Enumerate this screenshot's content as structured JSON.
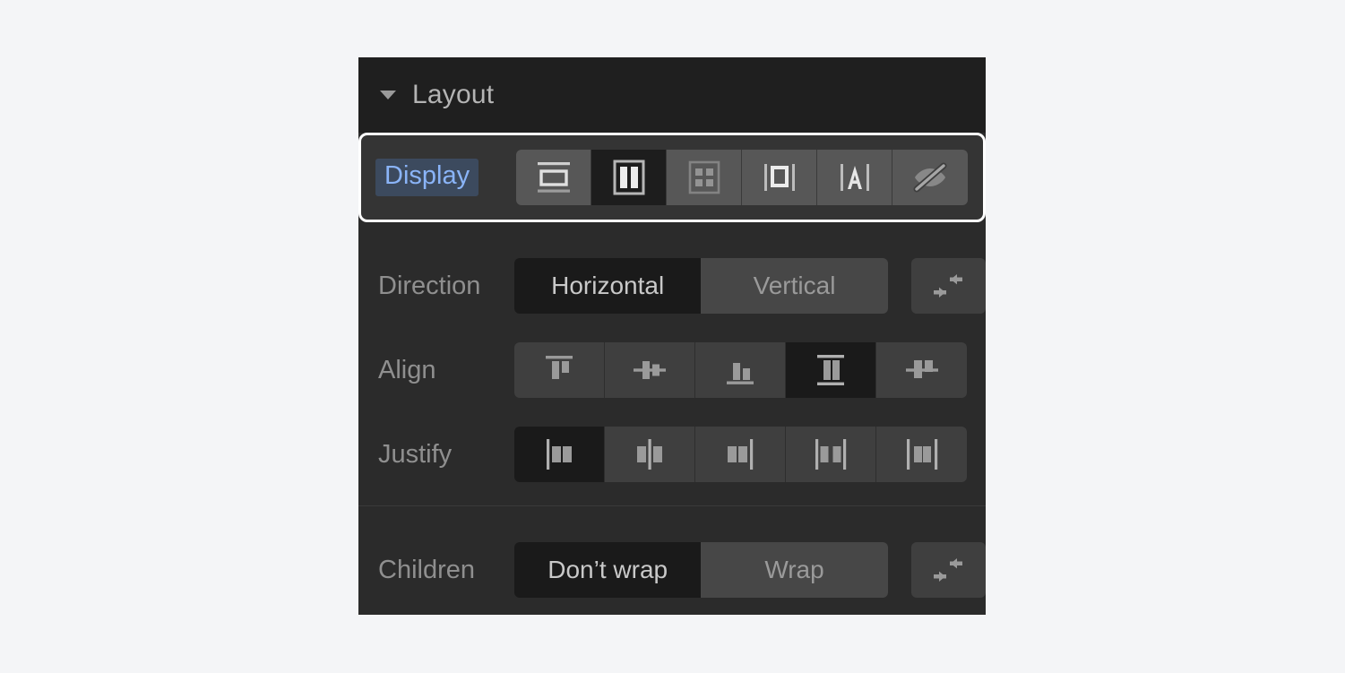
{
  "panel": {
    "title": "Layout",
    "disclosure_icon": "triangle-down-icon",
    "expanded": true
  },
  "display": {
    "label": "Display",
    "focused": true,
    "selected": "flex",
    "options": [
      {
        "value": "block",
        "icon": "display-block-icon",
        "selected": false,
        "dim": false
      },
      {
        "value": "flex",
        "icon": "display-flex-icon",
        "selected": true,
        "dim": false
      },
      {
        "value": "grid",
        "icon": "display-grid-icon",
        "selected": false,
        "dim": true
      },
      {
        "value": "inline-block",
        "icon": "display-inline-block-icon",
        "selected": false,
        "dim": false
      },
      {
        "value": "inline",
        "icon": "display-inline-icon",
        "selected": false,
        "dim": false
      },
      {
        "value": "none",
        "icon": "display-none-icon",
        "selected": false,
        "dim": false
      }
    ]
  },
  "direction": {
    "label": "Direction",
    "selected": "Horizontal",
    "options": [
      {
        "label": "Horizontal",
        "selected": true
      },
      {
        "label": "Vertical",
        "selected": false
      }
    ],
    "reverse_icon": "direction-reverse-icon"
  },
  "align": {
    "label": "Align",
    "selected": "stretch",
    "options": [
      {
        "value": "start",
        "icon": "align-start-icon",
        "selected": false
      },
      {
        "value": "center",
        "icon": "align-center-icon",
        "selected": false
      },
      {
        "value": "end",
        "icon": "align-end-icon",
        "selected": false
      },
      {
        "value": "stretch",
        "icon": "align-stretch-icon",
        "selected": true
      },
      {
        "value": "baseline",
        "icon": "align-baseline-icon",
        "selected": false
      }
    ]
  },
  "justify": {
    "label": "Justify",
    "selected": "start",
    "options": [
      {
        "value": "start",
        "icon": "justify-start-icon",
        "selected": true
      },
      {
        "value": "center",
        "icon": "justify-center-icon",
        "selected": false
      },
      {
        "value": "end",
        "icon": "justify-end-icon",
        "selected": false
      },
      {
        "value": "space-between",
        "icon": "justify-space-between-icon",
        "selected": false
      },
      {
        "value": "space-around",
        "icon": "justify-space-around-icon",
        "selected": false
      }
    ]
  },
  "children": {
    "label": "Children",
    "selected": "Don’t wrap",
    "options": [
      {
        "label": "Don’t wrap",
        "selected": true
      },
      {
        "label": "Wrap",
        "selected": false
      }
    ],
    "reverse_icon": "children-reverse-icon"
  },
  "colors": {
    "page_background": "#f4f5f7",
    "panel_background": "#2b2b2b",
    "header_background": "#1f1f1f",
    "display_row_background": "#343434",
    "focus_ring": "#ffffff",
    "label_text": "#8f8f8f",
    "display_label_text": "#8ab4f8",
    "display_label_highlight": "#3c4a5e",
    "button_background": "#3f3f3f",
    "button_active_background": "#1a1a1a",
    "icon_color": "#8f8f8f",
    "icon_color_bright": "#d8d8d8"
  }
}
